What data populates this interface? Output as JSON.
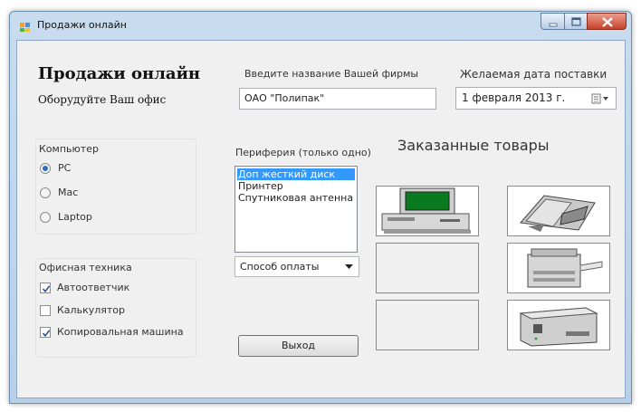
{
  "window": {
    "title": "Продажи онлайн"
  },
  "header": {
    "title": "Продажи онлайн",
    "subtitle": "Оборудуйте Ваш офис"
  },
  "company": {
    "label": "Введите название Вашей фирмы",
    "value": "ОАО \"Полипак\""
  },
  "delivery": {
    "label": "Желаемая дата поставки",
    "value": "1 февраля 2013 г."
  },
  "computer_group": {
    "title": "Компьютер",
    "options": [
      {
        "label": "PC",
        "selected": true
      },
      {
        "label": "Mac",
        "selected": false
      },
      {
        "label": "Laptop",
        "selected": false
      }
    ]
  },
  "office_group": {
    "title": "Офисная техника",
    "items": [
      {
        "label": "Автоответчик",
        "checked": true
      },
      {
        "label": "Калькулятор",
        "checked": false
      },
      {
        "label": "Копировальная машина",
        "checked": true
      }
    ]
  },
  "peripherals": {
    "label": "Периферия (только одно)",
    "items": [
      "Доп жесткий диск",
      "Принтер",
      "Спутниковая антенна"
    ],
    "selected_index": 0
  },
  "payment": {
    "placeholder": "Способ оплаты"
  },
  "exit_button": {
    "label": "Выход"
  },
  "ordered": {
    "title": "Заказанные товары"
  },
  "colors": {
    "title_bar": "#c9dcef",
    "selection": "#3399ff",
    "close_button": "#c7412a"
  }
}
